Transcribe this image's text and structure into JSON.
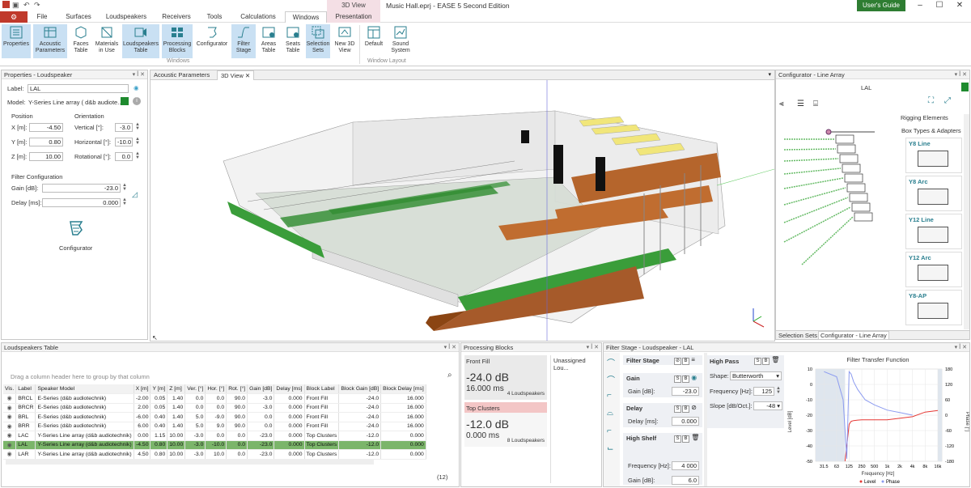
{
  "app": {
    "title": "Music Hall.eprj - EASE 5 Second Edition",
    "context_tab": "3D View",
    "user_guide": "User's Guide",
    "file_label": "File"
  },
  "menu": [
    "Surfaces",
    "Loudspeakers",
    "Receivers",
    "Tools",
    "Calculations",
    "Windows",
    "Presentation"
  ],
  "ribbon": {
    "buttons": [
      {
        "label": "Properties",
        "selected": true
      },
      {
        "label": "Acoustic Parameters",
        "selected": true
      },
      {
        "label": "Faces Table",
        "selected": false
      },
      {
        "label": "Materials in Use",
        "selected": false
      },
      {
        "label": "Loudspeakers Table",
        "selected": true
      },
      {
        "label": "Processing Blocks",
        "selected": true
      },
      {
        "label": "Configurator",
        "selected": false
      },
      {
        "label": "Filter Stage",
        "selected": true
      },
      {
        "label": "Areas Table",
        "selected": false
      },
      {
        "label": "Seats Table",
        "selected": false
      },
      {
        "label": "Selection Sets",
        "selected": true
      },
      {
        "label": "New 3D View",
        "selected": false
      },
      {
        "label": "Default",
        "selected": false
      },
      {
        "label": "Sound System",
        "selected": false
      }
    ],
    "group_windows": "Windows",
    "group_layout": "Window Layout"
  },
  "properties": {
    "title": "Properties - Loudspeaker",
    "label_caption": "Label:",
    "label_value": "LAL",
    "model_caption": "Model:",
    "model_value": "Y-Series Line array ( d&b audiote...",
    "position_caption": "Position",
    "orientation_caption": "Orientation",
    "x_caption": "X [m]:",
    "x_value": "-4.50",
    "y_caption": "Y [m]:",
    "y_value": "0.80",
    "z_caption": "Z [m]:",
    "z_value": "10.00",
    "vertical_caption": "Vertical [°]:",
    "vertical_value": "-3.0",
    "horizontal_caption": "Horizontal [°]:",
    "horizontal_value": "-10.0",
    "rotational_caption": "Rotational [°]:",
    "rotational_value": "0.0",
    "filter_config_caption": "Filter Configuration",
    "gain_caption": "Gain [dB]:",
    "gain_value": "-23.0",
    "delay_caption": "Delay [ms]:",
    "delay_value": "0.000",
    "configurator_label": "Configurator"
  },
  "view3d": {
    "tabs": [
      "Acoustic Parameters",
      "3D View"
    ]
  },
  "configurator": {
    "title": "Configurator - Line Array",
    "label": "LAL",
    "rigging_title": "Rigging Elements",
    "box_types_title": "Box Types & Adapters",
    "box_types": [
      "Y8 Line",
      "Y8 Arc",
      "Y12 Line",
      "Y12 Arc",
      "Y8-AP"
    ],
    "bottom_tabs": [
      "Selection Sets",
      "Configurator - Line Array"
    ]
  },
  "loudspeakers_table": {
    "title": "Loudspeakers Table",
    "group_hint": "Drag a column header here to group by that column",
    "columns": [
      "Vis.",
      "Label",
      "Speaker Model",
      "X [m]",
      "Y [m]",
      "Z [m]",
      "Ver. [°]",
      "Hor. [°]",
      "Rot. [°]",
      "Gain [dB]",
      "Delay [ms]",
      "Block Label",
      "Block Gain [dB]",
      "Block Delay [ms]"
    ],
    "rows": [
      [
        "",
        "BRCL",
        "E-Series (d&b audiotechnik)",
        "-2.00",
        "0.05",
        "1.40",
        "0.0",
        "0.0",
        "90.0",
        "-3.0",
        "0.000",
        "Front Fill",
        "-24.0",
        "16.000"
      ],
      [
        "",
        "BRCR",
        "E-Series (d&b audiotechnik)",
        "2.00",
        "0.05",
        "1.40",
        "0.0",
        "0.0",
        "90.0",
        "-3.0",
        "0.000",
        "Front Fill",
        "-24.0",
        "16.000"
      ],
      [
        "",
        "BRL",
        "E-Series (d&b audiotechnik)",
        "-6.00",
        "0.40",
        "1.40",
        "5.0",
        "-9.0",
        "90.0",
        "0.0",
        "0.000",
        "Front Fill",
        "-24.0",
        "16.000"
      ],
      [
        "",
        "BRR",
        "E-Series (d&b audiotechnik)",
        "6.00",
        "0.40",
        "1.40",
        "5.0",
        "9.0",
        "90.0",
        "0.0",
        "0.000",
        "Front Fill",
        "-24.0",
        "16.000"
      ],
      [
        "",
        "LAC",
        "Y-Series Line array (d&b audiotechnik)",
        "0.00",
        "1.15",
        "10.00",
        "-3.0",
        "0.0",
        "0.0",
        "-23.0",
        "0.000",
        "Top Clusters",
        "-12.0",
        "0.000"
      ],
      [
        "",
        "LAL",
        "Y-Series Line array (d&b audiotechnik)",
        "-4.50",
        "0.80",
        "10.00",
        "-3.0",
        "-10.0",
        "0.0",
        "-23.0",
        "0.000",
        "Top Clusters",
        "-12.0",
        "0.000"
      ],
      [
        "",
        "LAR",
        "Y-Series Line array (d&b audiotechnik)",
        "4.50",
        "0.80",
        "10.00",
        "-3.0",
        "10.0",
        "0.0",
        "-23.0",
        "0.000",
        "Top Clusters",
        "-12.0",
        "0.000"
      ]
    ],
    "selected_row": 5,
    "count": "(12)"
  },
  "processing_blocks": {
    "title": "Processing Blocks",
    "unassigned": "Unassigned Lou...",
    "blocks": [
      {
        "name": "Front Fill",
        "gain": "-24.0 dB",
        "delay": "16.000 ms",
        "count": "4 Loudspeakers",
        "color": "#e6e6e6"
      },
      {
        "name": "Top Clusters",
        "gain": "-12.0 dB",
        "delay": "0.000 ms",
        "count": "8 Loudspeakers",
        "color": "#f3c6c6"
      }
    ]
  },
  "filter_stage": {
    "title": "Filter Stage - Loudspeaker - LAL",
    "filter_stage_label": "Filter Stage",
    "gain_section": "Gain",
    "gain_caption": "Gain [dB]:",
    "gain_value": "-23.0",
    "delay_section": "Delay",
    "delay_caption": "Delay [ms]:",
    "delay_value": "0.000",
    "high_shelf_section": "High Shelf",
    "hs_freq_caption": "Frequency [Hz]:",
    "hs_freq_value": "4 000",
    "hs_gain_caption": "Gain [dB]:",
    "hs_gain_value": "6.0",
    "high_pass_section": "High Pass",
    "shape_caption": "Shape:",
    "shape_value": "Butterworth",
    "hp_freq_caption": "Frequency [Hz]:",
    "hp_freq_value": "125",
    "slope_caption": "Slope [dB/Oct.]:",
    "slope_value": "-48"
  },
  "chart_data": {
    "type": "line",
    "title": "Filter Transfer Function",
    "xlabel": "Frequency [Hz]",
    "ylabel": "Level [dB]",
    "y2label": "Phase [°]",
    "x_ticks": [
      "31.5",
      "63",
      "125",
      "250",
      "500",
      "1k",
      "2k",
      "4k",
      "8k",
      "16k"
    ],
    "y_ticks": [
      "10",
      "0",
      "-10",
      "-20",
      "-30",
      "-40",
      "-50"
    ],
    "y2_ticks": [
      "180",
      "120",
      "60",
      "0",
      "-60",
      "-120",
      "-180"
    ],
    "ylim": [
      -50,
      10
    ],
    "y2lim": [
      -180,
      180
    ],
    "legend": [
      "Level",
      "Phase"
    ],
    "series": [
      {
        "name": "Level",
        "color": "#e53935",
        "x": [
          100,
          112,
          125,
          140,
          160,
          200,
          250,
          400,
          1000,
          4000,
          8000,
          16000
        ],
        "values": [
          -50,
          -38,
          -26,
          -24,
          -23.5,
          -23.2,
          -23,
          -23,
          -23,
          -21,
          -18,
          -17
        ]
      },
      {
        "name": "Phase",
        "color": "#8c9bf0",
        "x": [
          31.5,
          63,
          90,
          110,
          125,
          140,
          160,
          200,
          300,
          500,
          1000,
          2000,
          4000
        ],
        "values": [
          170,
          150,
          60,
          -170,
          170,
          160,
          130,
          100,
          60,
          40,
          20,
          10,
          0
        ]
      }
    ]
  }
}
